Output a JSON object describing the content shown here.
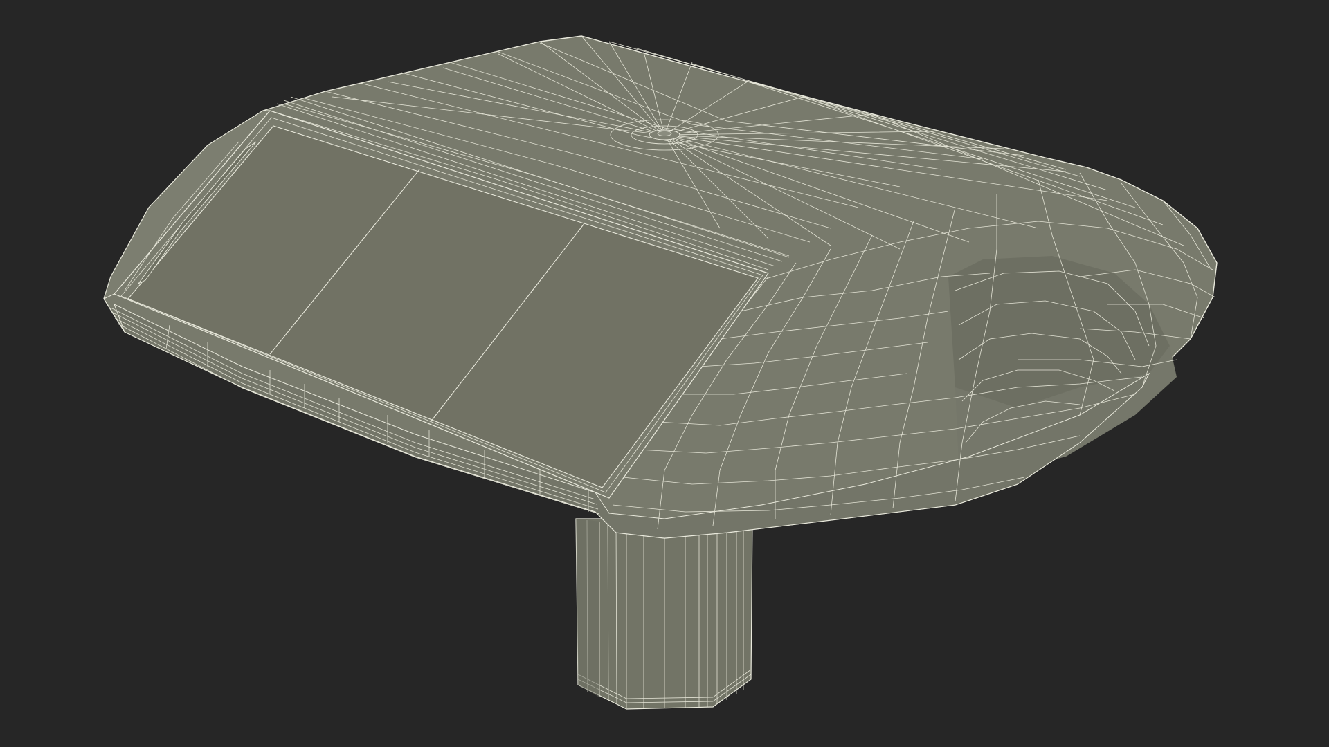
{
  "scene": {
    "background_color": "#262626",
    "surface_color": "#767869",
    "panel_color": "#717264",
    "wire_color": "#e9e9dc"
  },
  "objects": [
    {
      "name": "road-stud-body"
    },
    {
      "name": "reflector-panel"
    },
    {
      "name": "mounting-stem"
    }
  ]
}
